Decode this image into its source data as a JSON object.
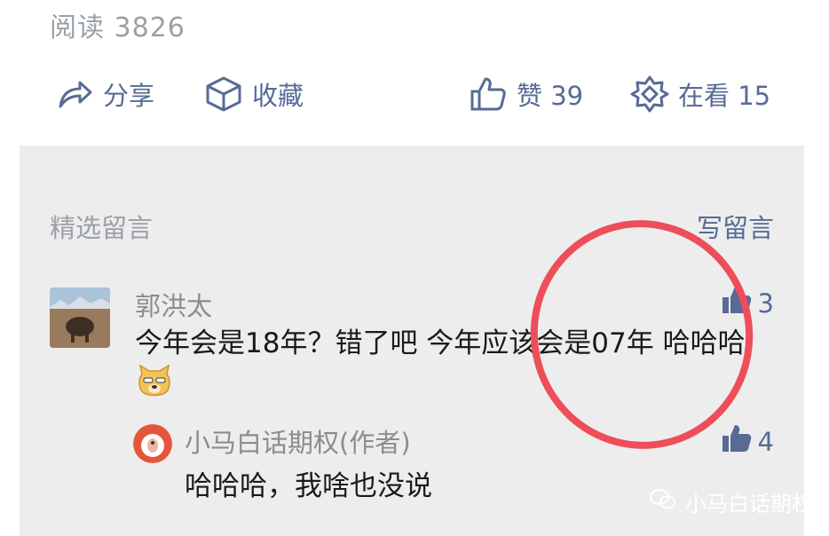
{
  "article": {
    "read_count": "阅读 3826",
    "actions": {
      "share": "分享",
      "favorite": "收藏",
      "like": "赞 39",
      "looking": "在看 15"
    }
  },
  "comments": {
    "section_title": "精选留言",
    "write_comment": "写留言",
    "items": [
      {
        "author": "郭洪太",
        "text": "今年会是18年？错了吧 今年应该会是07年 哈哈哈",
        "likes": "3",
        "reply": {
          "author": "小马白话期权(作者)",
          "text": "哈哈哈，我啥也没说",
          "likes": "4"
        }
      }
    ]
  },
  "watermark": {
    "text": "小马白话期权"
  },
  "colors": {
    "link": "#576b95",
    "muted": "#9aa0a6",
    "annotation": "#ee4d5a"
  }
}
